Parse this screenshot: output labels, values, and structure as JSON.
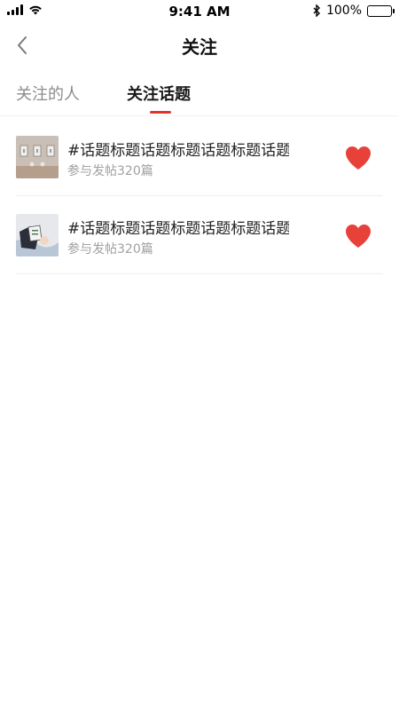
{
  "status_bar": {
    "time": "9:41 AM",
    "battery": "100%"
  },
  "nav": {
    "title": "关注",
    "back_icon": "chevron-left-icon"
  },
  "tabs": [
    {
      "label": "关注的人",
      "active": false
    },
    {
      "label": "关注话题",
      "active": true
    }
  ],
  "colors": {
    "accent": "#e0352b",
    "heart": "#e8413a",
    "muted_text": "#a0a0a0"
  },
  "topics": [
    {
      "title": "#话题标题话题标题话题标题话题标题…",
      "meta": "参与发帖320篇",
      "followed": true,
      "follow_icon": "heart-icon"
    },
    {
      "title": "#话题标题话题标题话题标题话题标题…",
      "meta": "参与发帖320篇",
      "followed": true,
      "follow_icon": "heart-icon"
    }
  ]
}
